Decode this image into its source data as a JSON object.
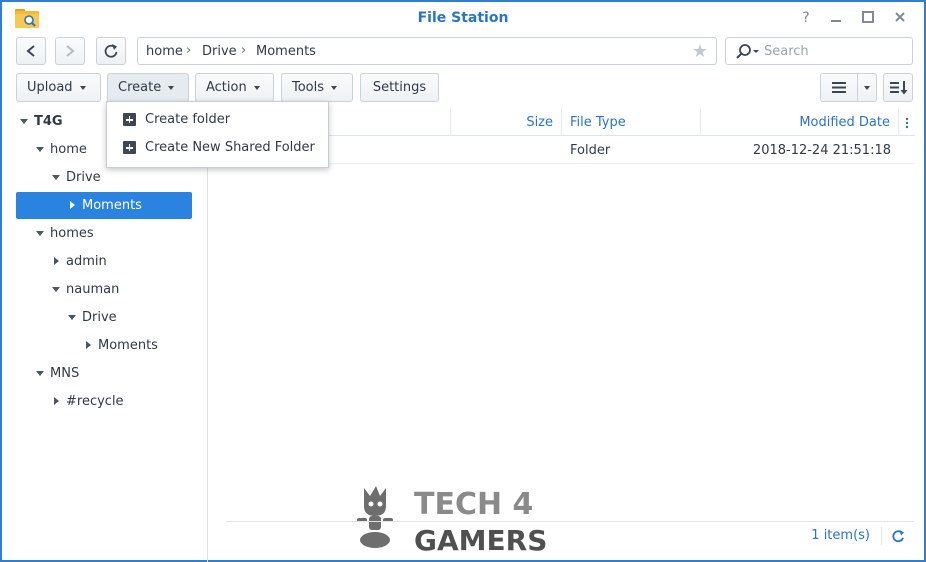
{
  "window": {
    "title": "File Station"
  },
  "path": {
    "crumbs": [
      "home",
      "Drive",
      "Moments"
    ]
  },
  "search": {
    "placeholder": "Search"
  },
  "toolbar": {
    "upload_label": "Upload",
    "create_label": "Create",
    "action_label": "Action",
    "tools_label": "Tools",
    "settings_label": "Settings"
  },
  "create_menu": {
    "items": [
      {
        "label": "Create folder",
        "icon": "plus-square-icon"
      },
      {
        "label": "Create New Shared Folder",
        "icon": "plus-square-icon"
      }
    ]
  },
  "tree": {
    "items": [
      {
        "label": "T4G",
        "expanded": true
      },
      {
        "label": "home",
        "expanded": true
      },
      {
        "label": "Drive",
        "expanded": true
      },
      {
        "label": "Moments",
        "selected": true
      },
      {
        "label": "homes",
        "expanded": true
      },
      {
        "label": "admin",
        "expanded": false
      },
      {
        "label": "nauman",
        "expanded": true
      },
      {
        "label": "Drive",
        "expanded": true
      },
      {
        "label": "Moments",
        "expanded": false
      },
      {
        "label": "MNS",
        "expanded": true
      },
      {
        "label": "#recycle",
        "expanded": false
      }
    ]
  },
  "grid": {
    "columns": {
      "size": "Size",
      "file_type": "File Type",
      "modified": "Modified Date"
    },
    "rows": [
      {
        "name": "",
        "size": "",
        "file_type": "Folder",
        "modified": "2018-12-24 21:51:18"
      }
    ]
  },
  "footer": {
    "item_count": "1 item(s)"
  },
  "watermark": {
    "line1": "TECH 4",
    "line2": "GAMERS"
  },
  "colors": {
    "accent": "#2a83de",
    "title": "#2a74c6",
    "border": "#2e7fcf"
  }
}
